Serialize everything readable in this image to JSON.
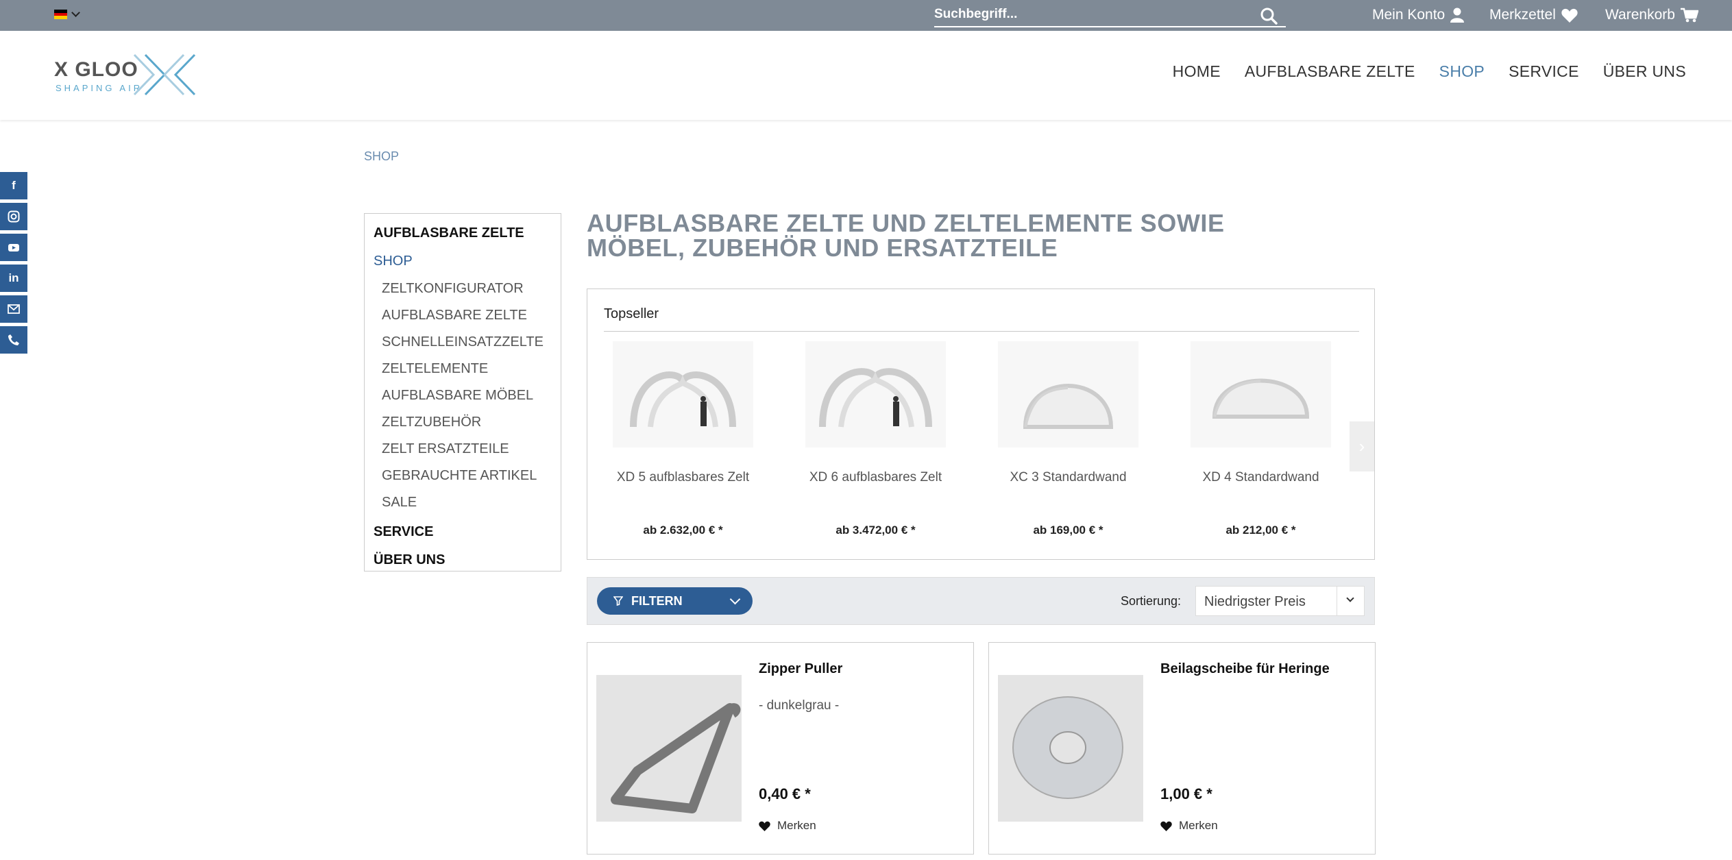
{
  "topbar": {
    "language": "DE",
    "search_placeholder": "Suchbegriff...",
    "account_label": "Mein Konto",
    "wishlist_label": "Merkzettel",
    "cart_label": "Warenkorb"
  },
  "logo": {
    "title": "X GLOO",
    "subtitle": "SHAPING AIR"
  },
  "nav": {
    "items": [
      "HOME",
      "AUFBLASBARE ZELTE",
      "SHOP",
      "SERVICE",
      "ÜBER UNS"
    ],
    "active": "SHOP"
  },
  "social": [
    "facebook-icon",
    "instagram-icon",
    "youtube-icon",
    "linkedin-icon",
    "mail-icon",
    "phone-icon"
  ],
  "breadcrumb": "SHOP",
  "sidebar": {
    "top1": "AUFBLASBARE ZELTE",
    "top2": "SHOP",
    "subitems": [
      "ZELTKONFIGURATOR",
      "AUFBLASBARE ZELTE",
      "SCHNELLEINSATZZELTE",
      "ZELTELEMENTE",
      "AUFBLASBARE MÖBEL",
      "ZELTZUBEHÖR",
      "ZELT ERSATZTEILE",
      "GEBRAUCHTE ARTIKEL",
      "SALE"
    ],
    "top3": "SERVICE",
    "top4": "ÜBER UNS"
  },
  "page_title": "AUFBLASBARE ZELTE UND ZELTELEMENTE SOWIE MÖBEL, ZUBEHÖR UND ERSATZTEILE",
  "topseller": {
    "title": "Topseller",
    "items": [
      {
        "name": "XD 5 aufblasbares Zelt",
        "price": "ab 2.632,00 € *"
      },
      {
        "name": "XD 6 aufblasbares Zelt",
        "price": "ab 3.472,00 € *"
      },
      {
        "name": "XC 3 Standardwand",
        "price": "ab 169,00 € *"
      },
      {
        "name": "XD 4 Standardwand",
        "price": "ab 212,00 € *"
      }
    ]
  },
  "filter": {
    "button": "FILTERN",
    "sort_label": "Sortierung:",
    "sort_value": "Niedrigster Preis"
  },
  "products": [
    {
      "name": "Zipper Puller",
      "variant": "- dunkelgrau -",
      "price": "0,40 € *",
      "wish": "Merken"
    },
    {
      "name": "Beilagscheibe für Heringe",
      "variant": "",
      "price": "1,00 € *",
      "wish": "Merken"
    }
  ],
  "colors": {
    "topbar": "#7f8a96",
    "brand_blue": "#2d5d94",
    "nav_active": "#4a7ea9"
  }
}
